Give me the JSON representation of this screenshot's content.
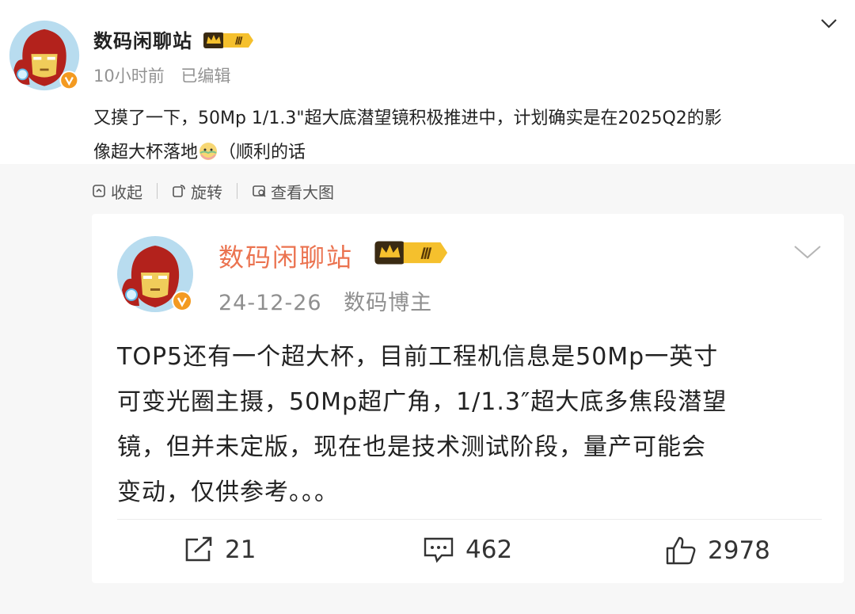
{
  "post": {
    "author": "数码闲聊站",
    "level_badge": "Ⅲ",
    "time": "10小时前",
    "edited": "已编辑",
    "text_line1": "又摸了一下，50Mp 1/1.3\"超大底潜望镜积极推进中，计划确实是在2025Q2的影",
    "text_line2a": "像超大杯落地",
    "text_line2b": "（顺利的话"
  },
  "toolbar": {
    "collapse": "收起",
    "rotate": "旋转",
    "view_large": "查看大图"
  },
  "quoted": {
    "author": "数码闲聊站",
    "level_badge": "Ⅲ",
    "date": "24-12-26",
    "role": "数码博主",
    "lines": [
      "TOP5还有一个超大杯，目前工程机信息是50Mp一英寸",
      "可变光圈主摄，50Mp超广角，1/1.3″超大底多焦段潜望",
      "镜，但并未定版，现在也是技术测试阶段，量产可能会",
      "变动，仅供参考。。。"
    ],
    "reposts": "21",
    "comments": "462",
    "likes": "2978"
  },
  "colors": {
    "accent_name": "#eb7350",
    "badge_gold": "#f5c02d",
    "verified": "#f39a21"
  }
}
